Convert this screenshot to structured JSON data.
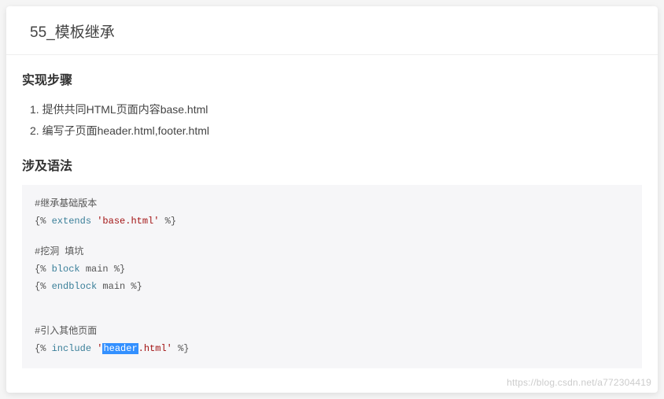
{
  "title": "55_模板继承",
  "sections": {
    "steps_heading": "实现步骤",
    "steps": [
      "提供共同HTML页面内容base.html",
      "编写子页面header.html,footer.html"
    ],
    "syntax_heading": "涉及语法"
  },
  "code": {
    "c1": "#继承基础版本",
    "c2_a": "{% ",
    "c2_kw": "extends",
    "c2_b": " ",
    "c2_str": "'base.html'",
    "c2_c": " %}",
    "c3": "",
    "c4": "#挖洞 填坑",
    "c5_a": "{% ",
    "c5_kw": "block",
    "c5_b": " main %}",
    "c6_a": "{% ",
    "c6_kw": "endblock",
    "c6_b": " main %}",
    "c7": "",
    "c8": "",
    "c9": "#引入其他页面",
    "c10_a": "{% ",
    "c10_kw": "include",
    "c10_b": " ",
    "c10_q1": "'",
    "c10_hl": "header",
    "c10_rest": ".html'",
    "c10_c": " %}"
  },
  "watermark": "https://blog.csdn.net/a772304419"
}
